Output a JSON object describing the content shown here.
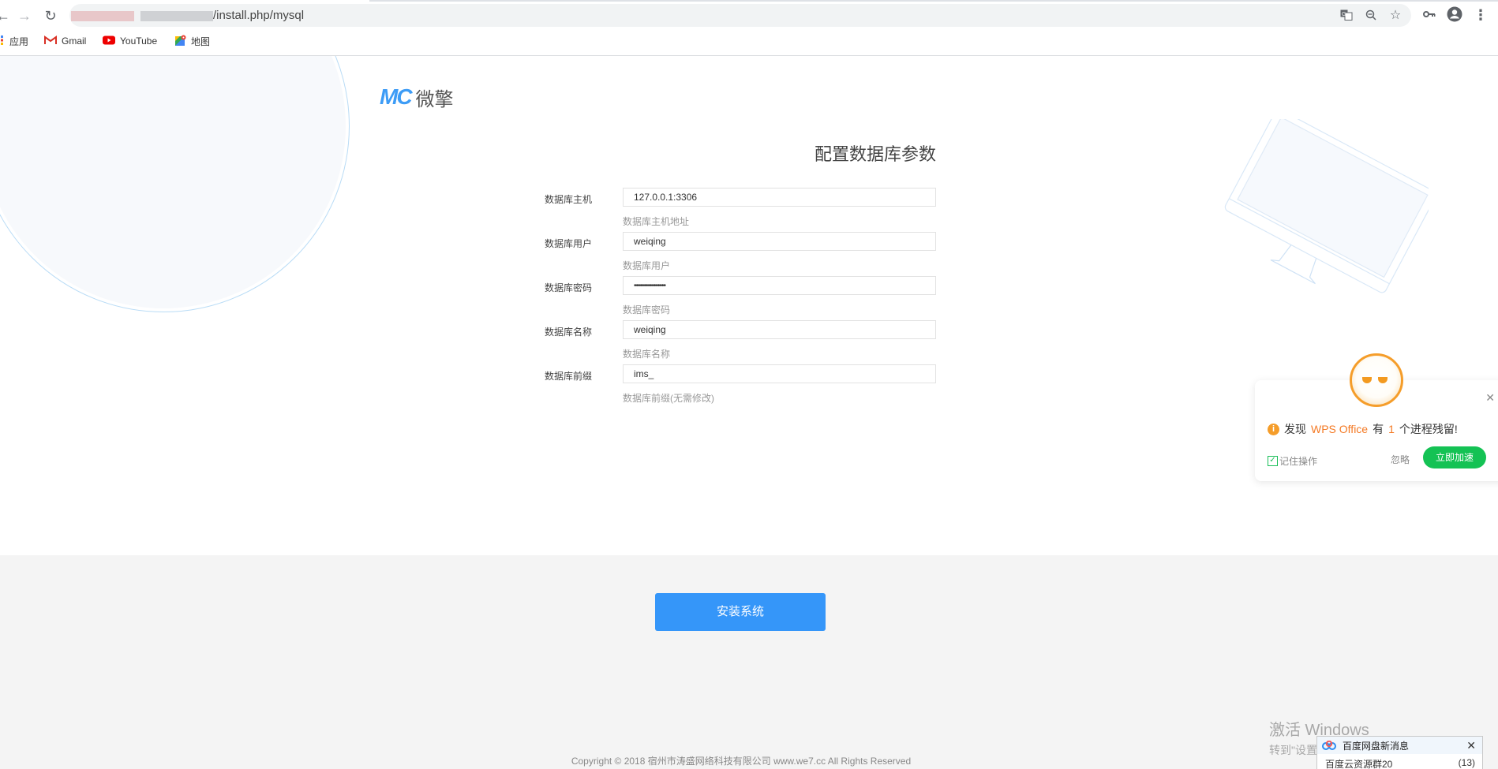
{
  "browser": {
    "url_visible": "/install.php/mysql",
    "bookmarks": [
      {
        "label": "应用",
        "icon": "apps-grid-icon"
      },
      {
        "label": "Gmail",
        "icon": "gmail-icon"
      },
      {
        "label": "YouTube",
        "icon": "youtube-icon"
      },
      {
        "label": "地图",
        "icon": "maps-icon"
      }
    ],
    "toolbar_icons": [
      "translate-icon",
      "zoom-icon",
      "star-icon",
      "key-icon",
      "profile-icon",
      "menu-icon"
    ]
  },
  "header": {
    "logo_mark": "MC",
    "logo_name": "微擎"
  },
  "form": {
    "title": "配置数据库参数",
    "fields": [
      {
        "label": "数据库主机",
        "value": "127.0.0.1:3306",
        "help": "数据库主机地址",
        "type": "text"
      },
      {
        "label": "数据库用户",
        "value": "weiqing",
        "help": "数据库用户",
        "type": "text"
      },
      {
        "label": "数据库密码",
        "value": "••••••••••••••••",
        "help": "数据库密码",
        "type": "password"
      },
      {
        "label": "数据库名称",
        "value": "weiqing",
        "help": "数据库名称",
        "type": "text"
      },
      {
        "label": "数据库前缀",
        "value": "ims_",
        "help": "数据库前缀(无需修改)",
        "type": "text"
      }
    ]
  },
  "footer": {
    "install_button": "安装系统",
    "copyright": "Copyright © 2018 宿州市涛盛网络科技有限公司 www.we7.cc All Rights Reserved"
  },
  "wps_popup": {
    "msg_prefix": "发现",
    "msg_app": "WPS Office",
    "msg_mid": "有",
    "msg_count": "1",
    "msg_suffix": "个进程残留!",
    "remember_label": "记住操作",
    "remember_checked": true,
    "ignore_label": "忽略",
    "speed_label": "立即加速",
    "accent": "#f47a25",
    "button_color": "#14c254"
  },
  "windows_watermark": {
    "line1": "激活 Windows",
    "line2": "转到\"设置\"以激活 Windows。"
  },
  "baidu_toast": {
    "title": "百度网盘新消息",
    "item_name": "百度云资源群20",
    "item_count": "(13)"
  },
  "colors": {
    "primary": "#3596f9",
    "logo": "#3d9cf6",
    "footer_bg": "#f4f4f4"
  }
}
